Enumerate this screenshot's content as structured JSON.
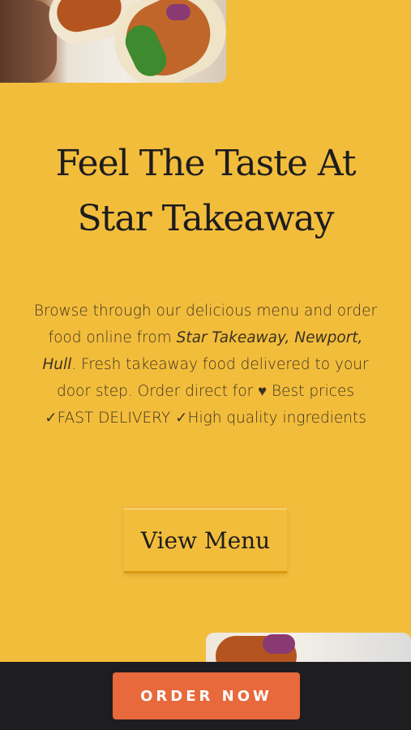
{
  "hero": {
    "headline_line1": "Feel The Taste At",
    "headline_line2": "Star Takeaway"
  },
  "intro": {
    "text_before": "Browse through our delicious menu and order food online from ",
    "location": "Star Takeaway, Newport, Hull",
    "text_after": ". Fresh takeaway food delivered to your door step. Order direct for ",
    "heart_icon": "♥",
    "best_prices": "Best prices",
    "check_icon": "✓",
    "fast_delivery": "FAST DELIVERY",
    "quality": "High quality ingredients"
  },
  "menu_button": {
    "label": "View Menu"
  },
  "order_button": {
    "label": "ORDER NOW"
  },
  "colors": {
    "background": "#f3bd3c",
    "order_button": "#e8693b",
    "bottom_bar": "#1e1e20"
  }
}
